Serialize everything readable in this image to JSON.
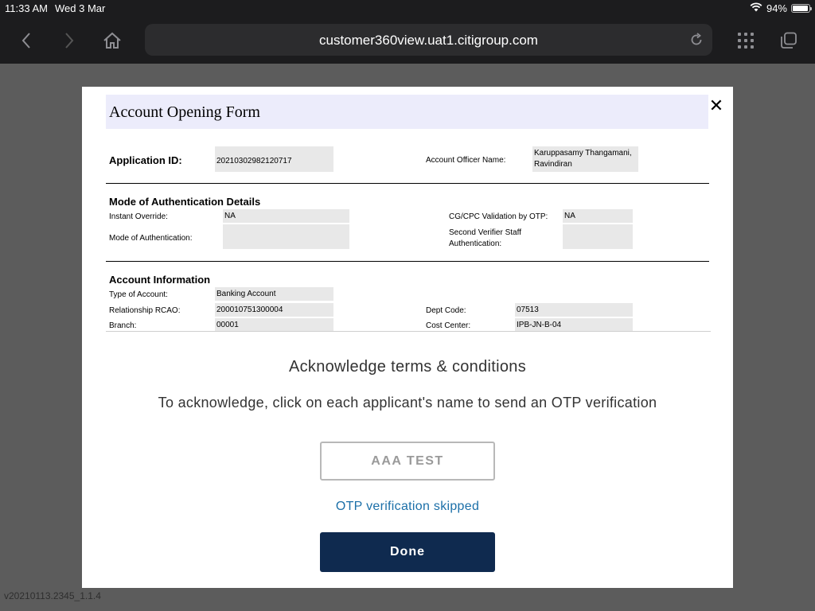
{
  "status_bar": {
    "time": "11:33 AM",
    "date": "Wed 3 Mar",
    "battery": "94%",
    "battery_level": 0.94
  },
  "browser": {
    "url": "customer360view.uat1.citigroup.com"
  },
  "form": {
    "title": "Account Opening Form",
    "application_id_label": "Application ID:",
    "application_id": "20210302982120717",
    "officer_label": "Account Officer Name:",
    "officer_name_line1": "Karuppasamy Thangamani,",
    "officer_name_line2": "Ravindiran",
    "auth_section": {
      "title": "Mode of Authentication Details",
      "instant_override_label": "Instant Override:",
      "instant_override": "NA",
      "cg_cpc_label": "CG/CPC Validation by OTP:",
      "cg_cpc": "NA",
      "mode_label": "Mode of Authentication:",
      "mode": "",
      "second_verifier_label_line1": "Second Verifier Staff",
      "second_verifier_label_line2": "Authentication:",
      "second_verifier": ""
    },
    "account_section": {
      "title": "Account Information",
      "type_label": "Type of Account:",
      "type": "Banking Account",
      "rcao_label": "Relationship RCAO:",
      "rcao": "200010751300004",
      "dept_label": "Dept Code:",
      "dept": "07513",
      "branch_label": "Branch:",
      "branch": "00001",
      "cost_center_label": "Cost Center:",
      "cost_center": "IPB-JN-B-04"
    }
  },
  "acknowledge": {
    "title": "Acknowledge terms & conditions",
    "subtitle": "To acknowledge, click on each applicant's name to send an OTP verification",
    "applicant_name": "AAA TEST",
    "otp_status": "OTP verification skipped",
    "done_label": "Done"
  },
  "footer": {
    "version": "v20210113.2345_1.1.4"
  },
  "icons": {
    "back": "chevron-left-icon",
    "forward": "chevron-right-icon",
    "home": "home-icon",
    "reload": "reload-icon",
    "tabs_grid": "grid-icon",
    "tabs": "tabs-icon",
    "wifi": "wifi-icon",
    "battery": "battery-icon",
    "close": "close-icon"
  },
  "colors": {
    "done_button": "#0f2a4f",
    "otp_status": "#1b6fa8",
    "form_title_bar": "#ececfb"
  }
}
